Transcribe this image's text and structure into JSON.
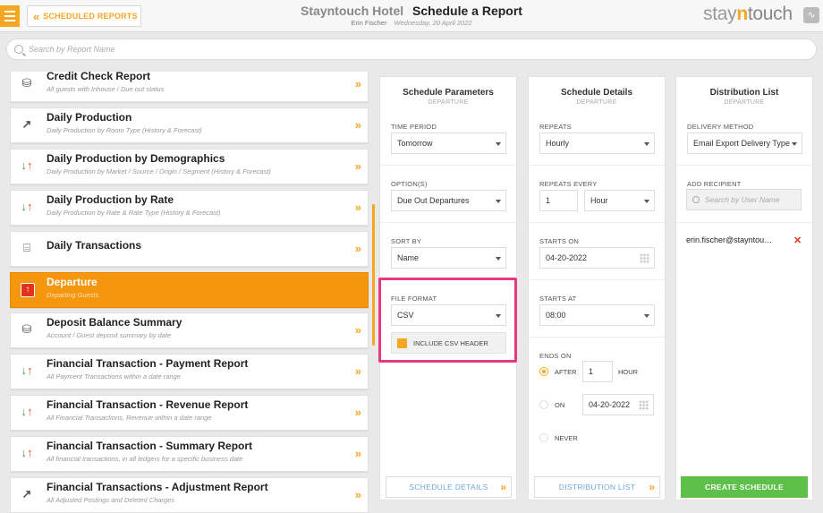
{
  "header": {
    "back_label": "SCHEDULED REPORTS",
    "hotel_name": "Stayntouch Hotel",
    "page_title": "Schedule a Report",
    "user_name": "Erin Fischer",
    "date": "Wednesday, 20 April 2022",
    "brand_prefix": "stay",
    "brand_n": "n",
    "brand_suffix": "touch"
  },
  "search": {
    "placeholder": "Search by Report Name"
  },
  "reports": [
    {
      "name": "Credit Check Report",
      "desc": "All guests with Inhouse / Due out status",
      "icon": "coins-icon"
    },
    {
      "name": "Daily Production",
      "desc": "Daily Production by Room Type (History & Forecast)",
      "icon": "trend-chart-icon"
    },
    {
      "name": "Daily Production by Demographics",
      "desc": "Daily Production by Market / Source / Origin / Segment (History & Forecast)",
      "icon": "up-down-arrows-icon"
    },
    {
      "name": "Daily Production by Rate",
      "desc": "Daily Production by Rate & Rate Type (History & Forecast)",
      "icon": "up-down-arrows-icon"
    },
    {
      "name": "Daily Transactions",
      "desc": "",
      "icon": "register-icon"
    },
    {
      "name": "Departure",
      "desc": "Departing Guests",
      "icon": "departure-icon"
    },
    {
      "name": "Deposit Balance Summary",
      "desc": "Account / Guest deposit summary by date",
      "icon": "coins-icon"
    },
    {
      "name": "Financial Transaction - Payment Report",
      "desc": "All Payment Transactions within a date range",
      "icon": "up-down-arrows-icon"
    },
    {
      "name": "Financial Transaction - Revenue Report",
      "desc": "All Financial Transactions, Revenue within a date range",
      "icon": "up-down-arrows-icon"
    },
    {
      "name": "Financial Transaction - Summary Report",
      "desc": "All financial transactions, in all ledgers for a specific business date",
      "icon": "up-down-arrows-icon"
    },
    {
      "name": "Financial Transactions - Adjustment Report",
      "desc": "All Adjusted Postings and Deleted Charges",
      "icon": "trend-chart-icon"
    }
  ],
  "schedule_parameters": {
    "title": "Schedule Parameters",
    "subtitle": "DEPARTURE",
    "time_period_label": "TIME PERIOD",
    "time_period_value": "Tomorrow",
    "options_label": "OPTION(S)",
    "options_value": "Due Out Departures",
    "sort_by_label": "SORT BY",
    "sort_by_value": "Name",
    "file_format_label": "FILE FORMAT",
    "file_format_value": "CSV",
    "include_csv_header_label": "INCLUDE CSV HEADER",
    "footer_button": "SCHEDULE DETAILS"
  },
  "schedule_details": {
    "title": "Schedule Details",
    "subtitle": "DEPARTURE",
    "repeats_label": "REPEATS",
    "repeats_value": "Hourly",
    "repeats_every_label": "REPEATS EVERY",
    "repeats_every_value": "1",
    "repeats_every_unit": "Hour",
    "starts_on_label": "STARTS ON",
    "starts_on_value": "04-20-2022",
    "starts_at_label": "STARTS AT",
    "starts_at_value": "08:00",
    "ends_on_label": "ENDS ON",
    "after_label": "AFTER",
    "after_value": "1",
    "after_unit": "HOUR",
    "on_label": "ON",
    "on_value": "04-20-2022",
    "never_label": "NEVER",
    "footer_button": "DISTRIBUTION LIST"
  },
  "distribution_list": {
    "title": "Distribution List",
    "subtitle": "DEPARTURE",
    "delivery_method_label": "DELIVERY METHOD",
    "delivery_method_value": "Email Export Delivery Type",
    "add_recipient_label": "ADD RECIPIENT",
    "search_user_placeholder": "Search by User Name",
    "recipient": "erin.fischer@stayntou…",
    "create_button": "CREATE SCHEDULE"
  },
  "colors": {
    "accent": "#f5a623",
    "active_row": "#f5960f",
    "create": "#5ec048",
    "highlight": "#e8387e",
    "link": "#6aa8d8"
  }
}
